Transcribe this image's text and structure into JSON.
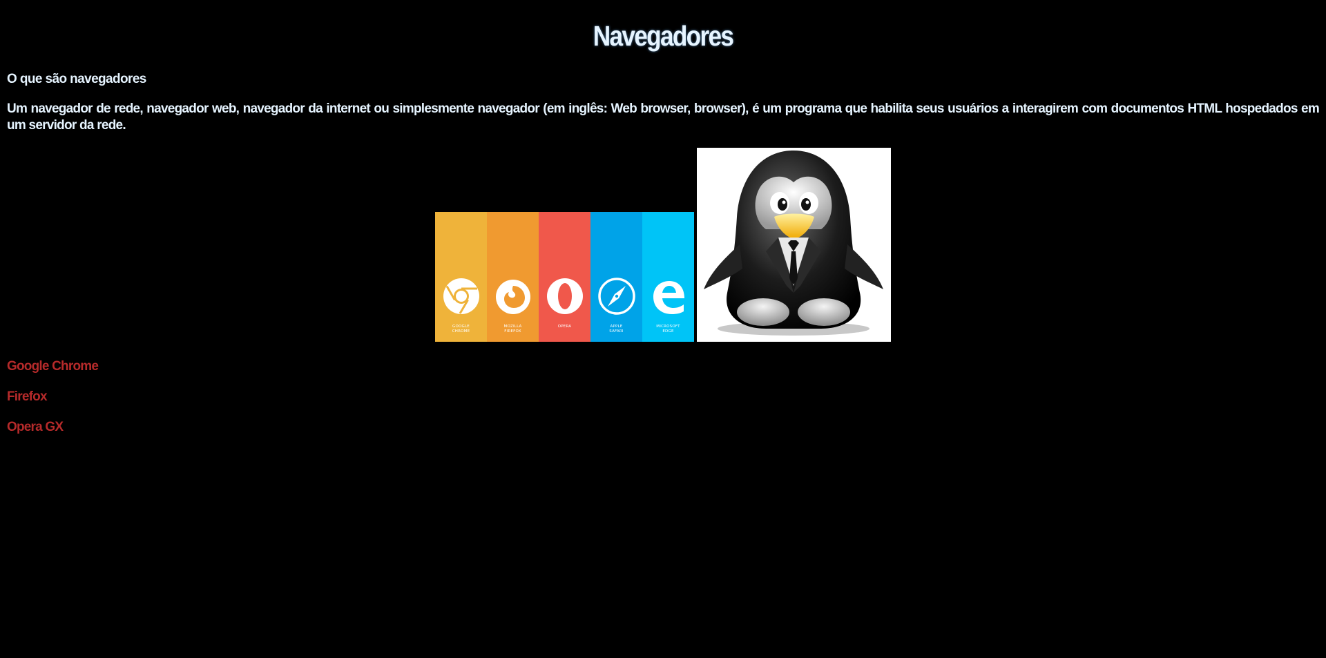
{
  "page": {
    "title": "Navegadores",
    "subheading": "O que são navegadores",
    "description": "Um navegador de rede, navegador web, navegador da internet ou simplesmente navegador (em inglês: Web browser, browser), é um programa que habilita seus usuários a interagirem com documentos HTML hospedados em um servidor da rede."
  },
  "browsers_image": {
    "columns": [
      {
        "caption_line1": "GOOGLE",
        "caption_line2": "CHROME",
        "color": "#efb33a",
        "icon": "chrome-icon"
      },
      {
        "caption_line1": "MOZILLA",
        "caption_line2": "FIREFOX",
        "color": "#f09a30",
        "icon": "firefox-icon"
      },
      {
        "caption_line1": "OPERA",
        "caption_line2": "",
        "color": "#f0584b",
        "icon": "opera-icon"
      },
      {
        "caption_line1": "APPLE",
        "caption_line2": "SAFARI",
        "color": "#00a3e8",
        "icon": "safari-icon"
      },
      {
        "caption_line1": "MICROSOFT",
        "caption_line2": "EDGE",
        "color": "#00c4f7",
        "icon": "edge-icon"
      }
    ]
  },
  "links": {
    "chrome": "Google Chrome",
    "firefox": "Firefox",
    "opera": "Opera GX"
  },
  "colors": {
    "background": "#000000",
    "text": "#e6f4ff",
    "link": "#b52a2a"
  }
}
